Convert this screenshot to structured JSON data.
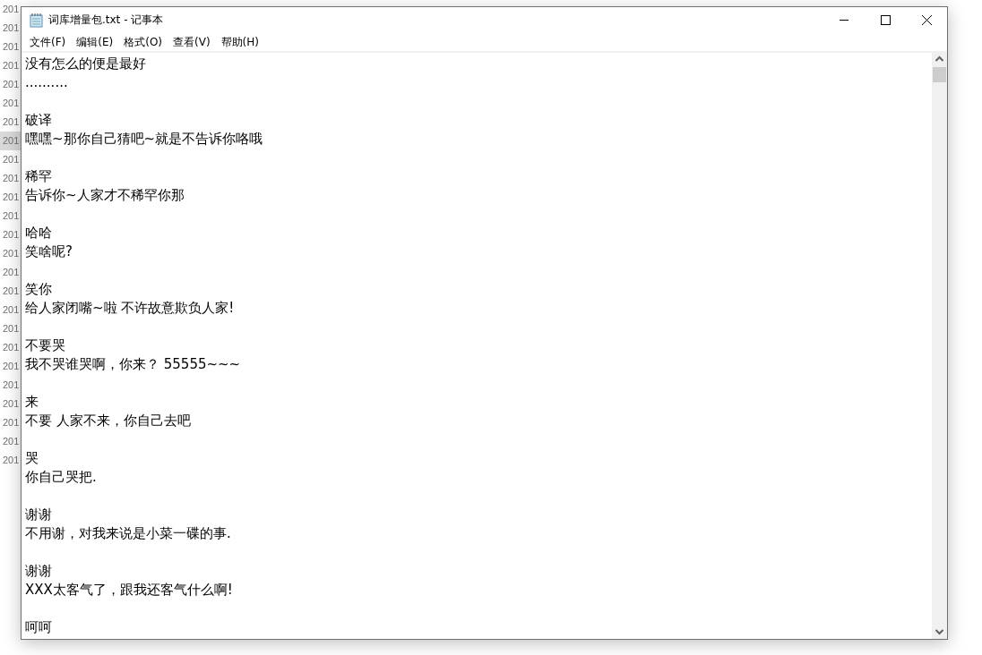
{
  "background_list": {
    "rows": [
      {
        "text": "201",
        "selected": false
      },
      {
        "text": "201",
        "selected": false
      },
      {
        "text": "201",
        "selected": false
      },
      {
        "text": "201",
        "selected": false
      },
      {
        "text": "201",
        "selected": false
      },
      {
        "text": "201",
        "selected": false
      },
      {
        "text": "201",
        "selected": false
      },
      {
        "text": "201",
        "selected": true
      },
      {
        "text": "201",
        "selected": false
      },
      {
        "text": "201",
        "selected": false
      },
      {
        "text": "201",
        "selected": false
      },
      {
        "text": "201",
        "selected": false
      },
      {
        "text": "201",
        "selected": false
      },
      {
        "text": "201",
        "selected": false
      },
      {
        "text": "201",
        "selected": false
      },
      {
        "text": "201",
        "selected": false
      },
      {
        "text": "201",
        "selected": false
      },
      {
        "text": "201",
        "selected": false
      },
      {
        "text": "201",
        "selected": false
      },
      {
        "text": "201",
        "selected": false
      },
      {
        "text": "201",
        "selected": false
      },
      {
        "text": "201",
        "selected": false
      },
      {
        "text": "201",
        "selected": false
      },
      {
        "text": "201",
        "selected": false
      },
      {
        "text": "201",
        "selected": false
      }
    ]
  },
  "window": {
    "title": "词库增量包.txt - 记事本"
  },
  "menu": [
    "文件(F)",
    "编辑(E)",
    "格式(O)",
    "查看(V)",
    "帮助(H)"
  ],
  "editor": {
    "paragraphs": [
      [
        "没有怎么的便是最好",
        ".........."
      ],
      [
        "破译",
        "嘿嘿~那你自己猜吧~就是不告诉你咯哦"
      ],
      [
        "稀罕",
        "告诉你~人家才不稀罕你那"
      ],
      [
        "哈哈",
        "笑啥呢?"
      ],
      [
        "笑你",
        "给人家闭嘴~啦 不许故意欺负人家!"
      ],
      [
        "不要哭",
        "我不哭谁哭啊，你来？ 55555~~~"
      ],
      [
        "来",
        "不要 人家不来，你自己去吧"
      ],
      [
        "哭",
        "你自己哭把."
      ],
      [
        "谢谢",
        "不用谢，对我来说是小菜一碟的事."
      ],
      [
        "谢谢",
        "XXX太客气了，跟我还客气什么啊!"
      ],
      [
        "呵呵"
      ]
    ]
  }
}
